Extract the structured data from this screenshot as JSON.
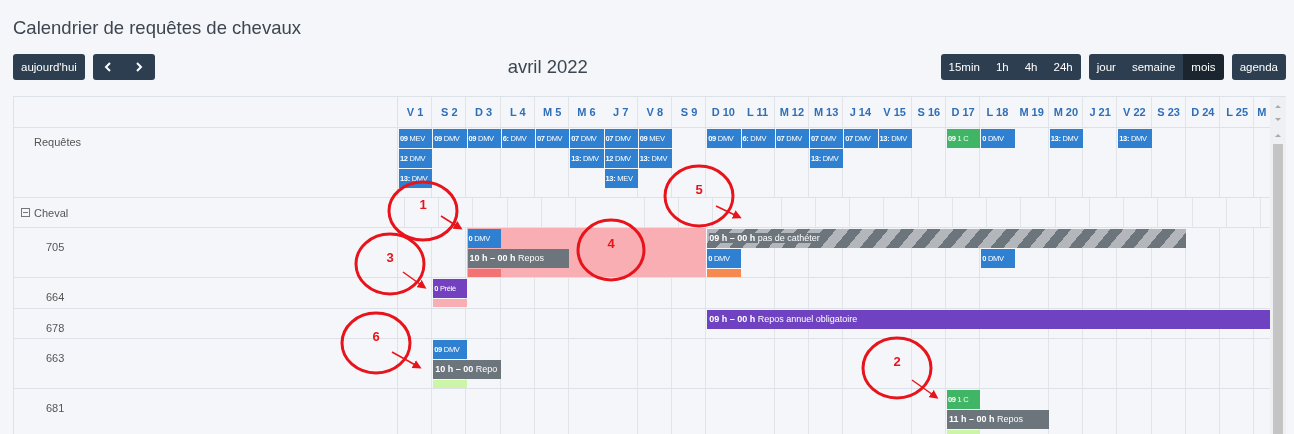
{
  "title": "Calendrier de requêtes de chevaux",
  "toolbar": {
    "today": "aujourd'hui",
    "period": "avril 2022",
    "zoom_buttons": [
      {
        "label": "15min",
        "selected": false
      },
      {
        "label": "1h",
        "selected": false
      },
      {
        "label": "4h",
        "selected": false
      },
      {
        "label": "24h",
        "selected": false
      }
    ],
    "view_buttons": [
      {
        "label": "jour",
        "selected": false
      },
      {
        "label": "semaine",
        "selected": false
      },
      {
        "label": "mois",
        "selected": true
      }
    ],
    "agenda_button": {
      "label": "agenda",
      "selected": false
    }
  },
  "days": [
    "V 1",
    "S 2",
    "D 3",
    "L 4",
    "M 5",
    "M 6",
    "J 7",
    "V 8",
    "S 9",
    "D 10",
    "L 11",
    "M 12",
    "M 13",
    "J 14",
    "V 15",
    "S 16",
    "D 17",
    "L 18",
    "M 19",
    "M 20",
    "J 21",
    "V 22",
    "S 23",
    "D 24",
    "L 25",
    "M"
  ],
  "rows": [
    {
      "kind": "resource",
      "label": "Requêtes",
      "lanes": [
        {
          "kind": "events",
          "cells": [
            {
              "kind": "event",
              "time": "09",
              "text": "MEV",
              "color": "#2f80d1",
              "striped": false
            },
            {
              "kind": "event",
              "time": "09",
              "text": "DMV",
              "color": "#2f80d1",
              "striped": false
            },
            {
              "kind": "event",
              "time": "09",
              "text": "DMV",
              "color": "#2f80d1",
              "striped": false
            },
            {
              "kind": "event",
              "time": "6:",
              "text": "DMV",
              "color": "#2f80d1",
              "striped": false
            },
            {
              "kind": "event",
              "time": "07",
              "text": "DMV",
              "color": "#2f80d1",
              "striped": false
            },
            {
              "kind": "event",
              "time": "07",
              "text": "DMV",
              "color": "#2f80d1",
              "striped": false
            },
            {
              "kind": "event",
              "time": "07",
              "text": "DMV",
              "color": "#2f80d1",
              "striped": false
            },
            {
              "kind": "event",
              "time": "09",
              "text": "MEV",
              "color": "#2f80d1",
              "striped": false
            },
            {
              "kind": "empty"
            },
            {
              "kind": "event",
              "time": "09",
              "text": "DMV",
              "color": "#2f80d1",
              "striped": false
            },
            {
              "kind": "event",
              "time": "6:",
              "text": "DMV",
              "color": "#2f80d1",
              "striped": false
            },
            {
              "kind": "event",
              "time": "07",
              "text": "DMV",
              "color": "#2f80d1",
              "striped": false
            },
            {
              "kind": "event",
              "time": "07",
              "text": "DMV",
              "color": "#2f80d1",
              "striped": false
            },
            {
              "kind": "event",
              "time": "07",
              "text": "DMV",
              "color": "#2f80d1",
              "striped": false
            },
            {
              "kind": "event",
              "time": "13:",
              "text": "DMV",
              "color": "#2f80d1",
              "striped": false
            },
            {
              "kind": "empty"
            },
            {
              "kind": "event",
              "time": "09",
              "text": "1 C",
              "color": "#3fb565",
              "striped": false
            },
            {
              "kind": "event",
              "time": "0",
              "text": "DMV",
              "color": "#2f80d1",
              "striped": false
            },
            {
              "kind": "empty"
            },
            {
              "kind": "event",
              "time": "13:",
              "text": "DMV",
              "color": "#2f80d1",
              "striped": false
            },
            {
              "kind": "empty"
            },
            {
              "kind": "event",
              "time": "13:",
              "text": "DMV",
              "color": "#2f80d1",
              "striped": false
            },
            {
              "kind": "empty"
            },
            {
              "kind": "empty"
            },
            {
              "kind": "empty"
            },
            {
              "kind": "empty"
            }
          ]
        },
        {
          "kind": "events",
          "cells": [
            {
              "kind": "event",
              "time": "12",
              "text": "DMV",
              "color": "#2f80d1",
              "striped": false
            },
            {
              "kind": "empty"
            },
            {
              "kind": "empty"
            },
            {
              "kind": "empty"
            },
            {
              "kind": "empty"
            },
            {
              "kind": "event",
              "time": "13:",
              "text": "DMV",
              "color": "#2f80d1",
              "striped": false
            },
            {
              "kind": "event",
              "time": "12",
              "text": "DMV",
              "color": "#2f80d1",
              "striped": false
            },
            {
              "kind": "event",
              "time": "13:",
              "text": "DMV",
              "color": "#2f80d1",
              "striped": false
            },
            {
              "kind": "empty"
            },
            {
              "kind": "empty"
            },
            {
              "kind": "empty"
            },
            {
              "kind": "empty"
            },
            {
              "kind": "event",
              "time": "13:",
              "text": "DMV",
              "color": "#2f80d1",
              "striped": false
            },
            {
              "kind": "empty"
            },
            {
              "kind": "empty"
            },
            {
              "kind": "empty"
            },
            {
              "kind": "empty"
            },
            {
              "kind": "empty"
            },
            {
              "kind": "empty"
            },
            {
              "kind": "empty"
            },
            {
              "kind": "empty"
            },
            {
              "kind": "empty"
            },
            {
              "kind": "empty"
            },
            {
              "kind": "empty"
            },
            {
              "kind": "empty"
            },
            {
              "kind": "empty"
            }
          ]
        },
        {
          "kind": "events",
          "cells": [
            {
              "kind": "event",
              "time": "13:",
              "text": "DMV",
              "color": "#2f80d1",
              "striped": false
            },
            {
              "kind": "empty"
            },
            {
              "kind": "empty"
            },
            {
              "kind": "empty"
            },
            {
              "kind": "empty"
            },
            {
              "kind": "empty"
            },
            {
              "kind": "event",
              "time": "13:",
              "text": "MEV",
              "color": "#2f80d1",
              "striped": false
            },
            {
              "kind": "empty"
            },
            {
              "kind": "empty"
            },
            {
              "kind": "empty"
            },
            {
              "kind": "empty"
            },
            {
              "kind": "empty"
            },
            {
              "kind": "empty"
            },
            {
              "kind": "empty"
            },
            {
              "kind": "empty"
            },
            {
              "kind": "empty"
            },
            {
              "kind": "empty"
            },
            {
              "kind": "empty"
            },
            {
              "kind": "empty"
            },
            {
              "kind": "empty"
            },
            {
              "kind": "empty"
            },
            {
              "kind": "empty"
            },
            {
              "kind": "empty"
            },
            {
              "kind": "empty"
            },
            {
              "kind": "empty"
            },
            {
              "kind": "empty"
            }
          ]
        }
      ]
    },
    {
      "kind": "group",
      "label": "Cheval",
      "expanded": true
    },
    {
      "kind": "resource",
      "label": "705",
      "lanes": [
        {
          "kind": "background",
          "cells": [
            {
              "kind": "empty"
            },
            {
              "kind": "empty"
            },
            {
              "kind": "band",
              "color": "#f8aeb2"
            },
            {
              "kind": "cont"
            },
            {
              "kind": "cont"
            },
            {
              "kind": "cont"
            },
            {
              "kind": "cont"
            },
            {
              "kind": "cont"
            },
            {
              "kind": "cont"
            },
            {
              "kind": "empty"
            },
            {
              "kind": "empty"
            },
            {
              "kind": "empty"
            },
            {
              "kind": "empty"
            },
            {
              "kind": "empty"
            },
            {
              "kind": "empty"
            },
            {
              "kind": "empty"
            },
            {
              "kind": "empty"
            },
            {
              "kind": "empty"
            },
            {
              "kind": "empty"
            },
            {
              "kind": "empty"
            },
            {
              "kind": "empty"
            },
            {
              "kind": "empty"
            },
            {
              "kind": "empty"
            },
            {
              "kind": "empty"
            },
            {
              "kind": "empty"
            },
            {
              "kind": "empty"
            }
          ]
        },
        {
          "kind": "events",
          "cells": [
            {
              "kind": "empty"
            },
            {
              "kind": "empty"
            },
            {
              "kind": "event",
              "time": "0",
              "text": "DMV",
              "color": "#2f80d1",
              "striped": false
            },
            {
              "kind": "empty"
            },
            {
              "kind": "empty"
            },
            {
              "kind": "empty"
            },
            {
              "kind": "empty"
            },
            {
              "kind": "empty"
            },
            {
              "kind": "empty"
            },
            {
              "kind": "event",
              "time": "09 h – 00 h",
              "text": "pas de cathéter",
              "color": "#6c747c",
              "striped": true
            },
            {
              "kind": "cont"
            },
            {
              "kind": "cont"
            },
            {
              "kind": "cont"
            },
            {
              "kind": "cont"
            },
            {
              "kind": "cont"
            },
            {
              "kind": "cont"
            },
            {
              "kind": "cont"
            },
            {
              "kind": "cont"
            },
            {
              "kind": "cont"
            },
            {
              "kind": "cont"
            },
            {
              "kind": "cont"
            },
            {
              "kind": "cont"
            },
            {
              "kind": "cont"
            },
            {
              "kind": "empty"
            },
            {
              "kind": "empty"
            },
            {
              "kind": "empty"
            }
          ]
        },
        {
          "kind": "events",
          "cells": [
            {
              "kind": "empty"
            },
            {
              "kind": "empty"
            },
            {
              "kind": "event",
              "time": "10 h – 00 h",
              "text": "Repos",
              "color": "#6c747c",
              "striped": false
            },
            {
              "kind": "cont"
            },
            {
              "kind": "cont"
            },
            {
              "kind": "empty"
            },
            {
              "kind": "empty"
            },
            {
              "kind": "empty"
            },
            {
              "kind": "empty"
            },
            {
              "kind": "event",
              "time": "0",
              "text": "DMV",
              "color": "#2f80d1",
              "striped": false
            },
            {
              "kind": "empty"
            },
            {
              "kind": "empty"
            },
            {
              "kind": "empty"
            },
            {
              "kind": "empty"
            },
            {
              "kind": "empty"
            },
            {
              "kind": "empty"
            },
            {
              "kind": "empty"
            },
            {
              "kind": "event",
              "time": "0",
              "text": "DMV",
              "color": "#2f80d1",
              "striped": false
            },
            {
              "kind": "empty"
            },
            {
              "kind": "empty"
            },
            {
              "kind": "empty"
            },
            {
              "kind": "empty"
            },
            {
              "kind": "empty"
            },
            {
              "kind": "empty"
            },
            {
              "kind": "empty"
            },
            {
              "kind": "empty"
            }
          ]
        },
        {
          "kind": "strip",
          "cells": [
            {
              "kind": "empty"
            },
            {
              "kind": "empty"
            },
            {
              "kind": "strip",
              "color": "#f27373"
            },
            {
              "kind": "empty"
            },
            {
              "kind": "empty"
            },
            {
              "kind": "empty"
            },
            {
              "kind": "empty"
            },
            {
              "kind": "empty"
            },
            {
              "kind": "empty"
            },
            {
              "kind": "strip",
              "color": "#f5894f"
            },
            {
              "kind": "empty"
            },
            {
              "kind": "empty"
            },
            {
              "kind": "empty"
            },
            {
              "kind": "empty"
            },
            {
              "kind": "empty"
            },
            {
              "kind": "empty"
            },
            {
              "kind": "empty"
            },
            {
              "kind": "empty"
            },
            {
              "kind": "empty"
            },
            {
              "kind": "empty"
            },
            {
              "kind": "empty"
            },
            {
              "kind": "empty"
            },
            {
              "kind": "empty"
            },
            {
              "kind": "empty"
            },
            {
              "kind": "empty"
            },
            {
              "kind": "empty"
            }
          ]
        }
      ]
    },
    {
      "kind": "resource",
      "label": "664",
      "lanes": [
        {
          "kind": "events",
          "cells": [
            {
              "kind": "empty"
            },
            {
              "kind": "event",
              "time": "0",
              "text": "Prélè",
              "color": "#7340c0",
              "striped": false
            },
            {
              "kind": "empty"
            },
            {
              "kind": "empty"
            },
            {
              "kind": "empty"
            },
            {
              "kind": "empty"
            },
            {
              "kind": "empty"
            },
            {
              "kind": "empty"
            },
            {
              "kind": "empty"
            },
            {
              "kind": "empty"
            },
            {
              "kind": "empty"
            },
            {
              "kind": "empty"
            },
            {
              "kind": "empty"
            },
            {
              "kind": "empty"
            },
            {
              "kind": "empty"
            },
            {
              "kind": "empty"
            },
            {
              "kind": "empty"
            },
            {
              "kind": "empty"
            },
            {
              "kind": "empty"
            },
            {
              "kind": "empty"
            },
            {
              "kind": "empty"
            },
            {
              "kind": "empty"
            },
            {
              "kind": "empty"
            },
            {
              "kind": "empty"
            },
            {
              "kind": "empty"
            },
            {
              "kind": "empty"
            }
          ]
        },
        {
          "kind": "strip",
          "cells": [
            {
              "kind": "empty"
            },
            {
              "kind": "strip",
              "color": "#f8aeb2"
            },
            {
              "kind": "empty"
            },
            {
              "kind": "empty"
            },
            {
              "kind": "empty"
            },
            {
              "kind": "empty"
            },
            {
              "kind": "empty"
            },
            {
              "kind": "empty"
            },
            {
              "kind": "empty"
            },
            {
              "kind": "empty"
            },
            {
              "kind": "empty"
            },
            {
              "kind": "empty"
            },
            {
              "kind": "empty"
            },
            {
              "kind": "empty"
            },
            {
              "kind": "empty"
            },
            {
              "kind": "empty"
            },
            {
              "kind": "empty"
            },
            {
              "kind": "empty"
            },
            {
              "kind": "empty"
            },
            {
              "kind": "empty"
            },
            {
              "kind": "empty"
            },
            {
              "kind": "empty"
            },
            {
              "kind": "empty"
            },
            {
              "kind": "empty"
            },
            {
              "kind": "empty"
            },
            {
              "kind": "empty"
            }
          ]
        }
      ]
    },
    {
      "kind": "resource",
      "label": "678",
      "lanes": [
        {
          "kind": "events",
          "cells": [
            {
              "kind": "empty"
            },
            {
              "kind": "empty"
            },
            {
              "kind": "empty"
            },
            {
              "kind": "empty"
            },
            {
              "kind": "empty"
            },
            {
              "kind": "empty"
            },
            {
              "kind": "empty"
            },
            {
              "kind": "empty"
            },
            {
              "kind": "empty"
            },
            {
              "kind": "event",
              "time": "09 h – 00 h",
              "text": "Repos annuel obligatoire",
              "color": "#6f42c1",
              "striped": false
            },
            {
              "kind": "cont"
            },
            {
              "kind": "cont"
            },
            {
              "kind": "cont"
            },
            {
              "kind": "cont"
            },
            {
              "kind": "cont"
            },
            {
              "kind": "cont"
            },
            {
              "kind": "cont"
            },
            {
              "kind": "cont"
            },
            {
              "kind": "cont"
            },
            {
              "kind": "cont"
            },
            {
              "kind": "cont"
            },
            {
              "kind": "cont"
            },
            {
              "kind": "cont"
            },
            {
              "kind": "cont"
            },
            {
              "kind": "cont"
            },
            {
              "kind": "cont"
            }
          ]
        }
      ]
    },
    {
      "kind": "resource",
      "label": "663",
      "lanes": [
        {
          "kind": "events",
          "cells": [
            {
              "kind": "empty"
            },
            {
              "kind": "event",
              "time": "09",
              "text": "DMV",
              "color": "#2f80d1",
              "striped": false
            },
            {
              "kind": "empty"
            },
            {
              "kind": "empty"
            },
            {
              "kind": "empty"
            },
            {
              "kind": "empty"
            },
            {
              "kind": "empty"
            },
            {
              "kind": "empty"
            },
            {
              "kind": "empty"
            },
            {
              "kind": "empty"
            },
            {
              "kind": "empty"
            },
            {
              "kind": "empty"
            },
            {
              "kind": "empty"
            },
            {
              "kind": "empty"
            },
            {
              "kind": "empty"
            },
            {
              "kind": "empty"
            },
            {
              "kind": "empty"
            },
            {
              "kind": "empty"
            },
            {
              "kind": "empty"
            },
            {
              "kind": "empty"
            },
            {
              "kind": "empty"
            },
            {
              "kind": "empty"
            },
            {
              "kind": "empty"
            },
            {
              "kind": "empty"
            },
            {
              "kind": "empty"
            },
            {
              "kind": "empty"
            }
          ]
        },
        {
          "kind": "events",
          "cells": [
            {
              "kind": "empty"
            },
            {
              "kind": "event",
              "time": "10 h – 00",
              "text": "Repo",
              "color": "#6c747c",
              "striped": false
            },
            {
              "kind": "cont"
            },
            {
              "kind": "empty"
            },
            {
              "kind": "empty"
            },
            {
              "kind": "empty"
            },
            {
              "kind": "empty"
            },
            {
              "kind": "empty"
            },
            {
              "kind": "empty"
            },
            {
              "kind": "empty"
            },
            {
              "kind": "empty"
            },
            {
              "kind": "empty"
            },
            {
              "kind": "empty"
            },
            {
              "kind": "empty"
            },
            {
              "kind": "empty"
            },
            {
              "kind": "empty"
            },
            {
              "kind": "empty"
            },
            {
              "kind": "empty"
            },
            {
              "kind": "empty"
            },
            {
              "kind": "empty"
            },
            {
              "kind": "empty"
            },
            {
              "kind": "empty"
            },
            {
              "kind": "empty"
            },
            {
              "kind": "empty"
            },
            {
              "kind": "empty"
            },
            {
              "kind": "empty"
            }
          ]
        },
        {
          "kind": "strip",
          "cells": [
            {
              "kind": "empty"
            },
            {
              "kind": "strip",
              "color": "#ccf5a8"
            },
            {
              "kind": "empty"
            },
            {
              "kind": "empty"
            },
            {
              "kind": "empty"
            },
            {
              "kind": "empty"
            },
            {
              "kind": "empty"
            },
            {
              "kind": "empty"
            },
            {
              "kind": "empty"
            },
            {
              "kind": "empty"
            },
            {
              "kind": "empty"
            },
            {
              "kind": "empty"
            },
            {
              "kind": "empty"
            },
            {
              "kind": "empty"
            },
            {
              "kind": "empty"
            },
            {
              "kind": "empty"
            },
            {
              "kind": "empty"
            },
            {
              "kind": "empty"
            },
            {
              "kind": "empty"
            },
            {
              "kind": "empty"
            },
            {
              "kind": "empty"
            },
            {
              "kind": "empty"
            },
            {
              "kind": "empty"
            },
            {
              "kind": "empty"
            },
            {
              "kind": "empty"
            },
            {
              "kind": "empty"
            }
          ]
        }
      ]
    },
    {
      "kind": "resource",
      "label": "681",
      "lanes": [
        {
          "kind": "events",
          "cells": [
            {
              "kind": "empty"
            },
            {
              "kind": "empty"
            },
            {
              "kind": "empty"
            },
            {
              "kind": "empty"
            },
            {
              "kind": "empty"
            },
            {
              "kind": "empty"
            },
            {
              "kind": "empty"
            },
            {
              "kind": "empty"
            },
            {
              "kind": "empty"
            },
            {
              "kind": "empty"
            },
            {
              "kind": "empty"
            },
            {
              "kind": "empty"
            },
            {
              "kind": "empty"
            },
            {
              "kind": "empty"
            },
            {
              "kind": "empty"
            },
            {
              "kind": "empty"
            },
            {
              "kind": "event",
              "time": "09",
              "text": "1 C",
              "color": "#3fb565",
              "striped": false
            },
            {
              "kind": "empty"
            },
            {
              "kind": "empty"
            },
            {
              "kind": "empty"
            },
            {
              "kind": "empty"
            },
            {
              "kind": "empty"
            },
            {
              "kind": "empty"
            },
            {
              "kind": "empty"
            },
            {
              "kind": "empty"
            },
            {
              "kind": "empty"
            }
          ]
        },
        {
          "kind": "events",
          "cells": [
            {
              "kind": "empty"
            },
            {
              "kind": "empty"
            },
            {
              "kind": "empty"
            },
            {
              "kind": "empty"
            },
            {
              "kind": "empty"
            },
            {
              "kind": "empty"
            },
            {
              "kind": "empty"
            },
            {
              "kind": "empty"
            },
            {
              "kind": "empty"
            },
            {
              "kind": "empty"
            },
            {
              "kind": "empty"
            },
            {
              "kind": "empty"
            },
            {
              "kind": "empty"
            },
            {
              "kind": "empty"
            },
            {
              "kind": "empty"
            },
            {
              "kind": "empty"
            },
            {
              "kind": "event",
              "time": "11 h – 00 h",
              "text": "Repos",
              "color": "#6c747c",
              "striped": false
            },
            {
              "kind": "cont"
            },
            {
              "kind": "cont"
            },
            {
              "kind": "empty"
            },
            {
              "kind": "empty"
            },
            {
              "kind": "empty"
            },
            {
              "kind": "empty"
            },
            {
              "kind": "empty"
            },
            {
              "kind": "empty"
            },
            {
              "kind": "empty"
            }
          ]
        },
        {
          "kind": "strip",
          "cells": [
            {
              "kind": "empty"
            },
            {
              "kind": "empty"
            },
            {
              "kind": "empty"
            },
            {
              "kind": "empty"
            },
            {
              "kind": "empty"
            },
            {
              "kind": "empty"
            },
            {
              "kind": "empty"
            },
            {
              "kind": "empty"
            },
            {
              "kind": "empty"
            },
            {
              "kind": "empty"
            },
            {
              "kind": "empty"
            },
            {
              "kind": "empty"
            },
            {
              "kind": "empty"
            },
            {
              "kind": "empty"
            },
            {
              "kind": "empty"
            },
            {
              "kind": "empty"
            },
            {
              "kind": "strip",
              "color": "#ccf5a8"
            },
            {
              "kind": "empty"
            },
            {
              "kind": "empty"
            },
            {
              "kind": "empty"
            },
            {
              "kind": "empty"
            },
            {
              "kind": "empty"
            },
            {
              "kind": "empty"
            },
            {
              "kind": "empty"
            },
            {
              "kind": "empty"
            },
            {
              "kind": "empty"
            }
          ]
        }
      ]
    }
  ],
  "annotations": [
    {
      "label": "1"
    },
    {
      "label": "2"
    },
    {
      "label": "3"
    },
    {
      "label": "4"
    },
    {
      "label": "5"
    },
    {
      "label": "6"
    }
  ]
}
